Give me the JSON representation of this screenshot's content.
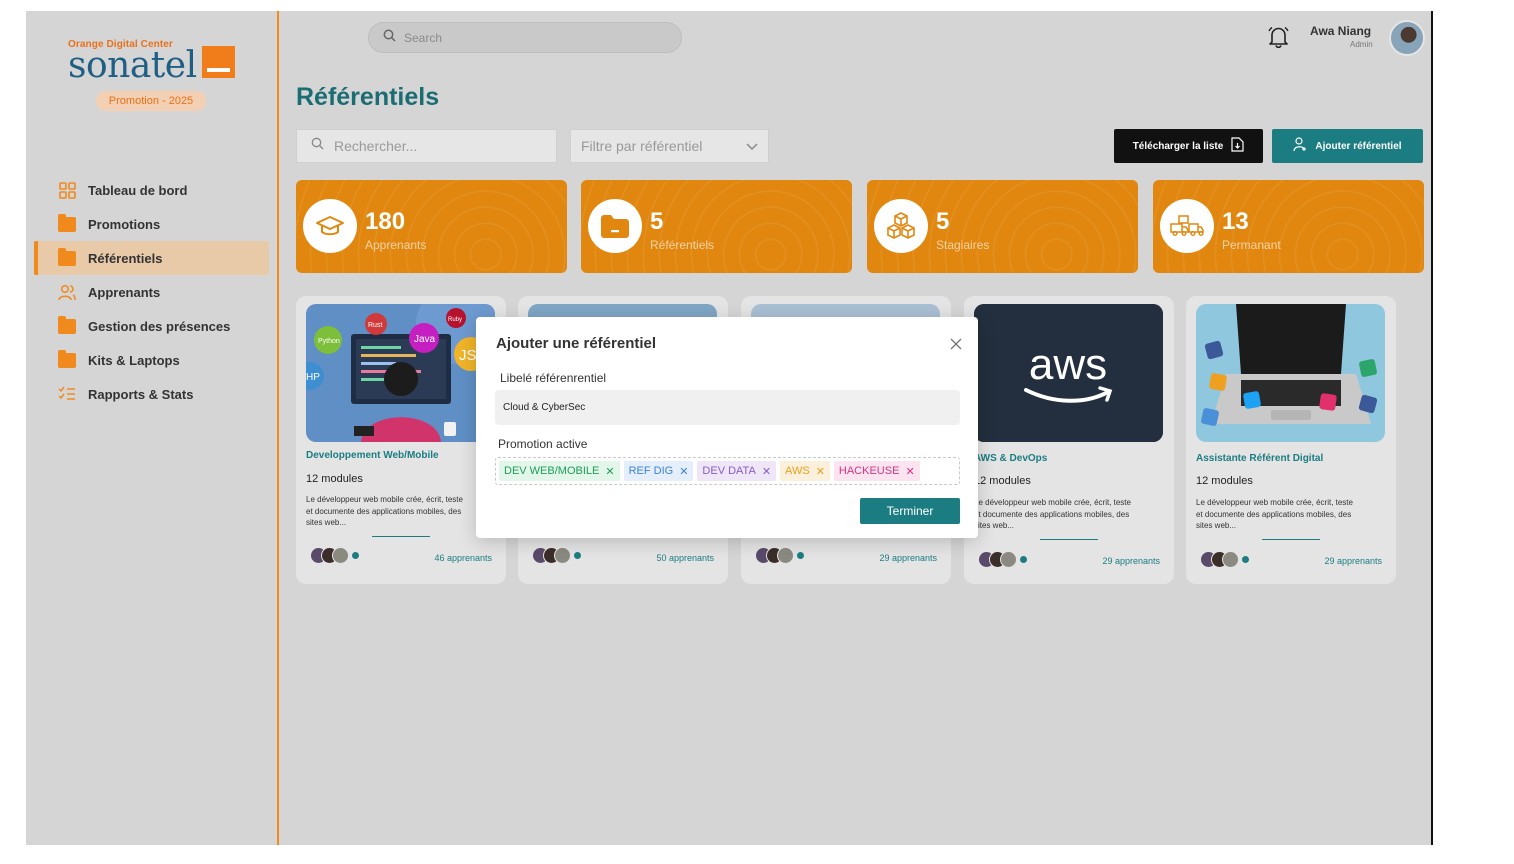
{
  "sidebar": {
    "logo_small": "Orange Digital Center",
    "logo_big": "sonatel",
    "promotion_pill": "Promotion - 2025",
    "items": [
      {
        "label": "Tableau de bord",
        "icon": "grid-icon",
        "active": false
      },
      {
        "label": "Promotions",
        "icon": "folder-icon",
        "active": false
      },
      {
        "label": "Référentiels",
        "icon": "folder-icon",
        "active": true
      },
      {
        "label": "Apprenants",
        "icon": "users-icon",
        "active": false
      },
      {
        "label": "Gestion des présences",
        "icon": "folder-icon",
        "active": false
      },
      {
        "label": "Kits & Laptops",
        "icon": "folder-icon",
        "active": false
      },
      {
        "label": "Rapports & Stats",
        "icon": "checklist-icon",
        "active": false
      }
    ]
  },
  "topbar": {
    "search_placeholder": "Search",
    "user_name": "Awa Niang",
    "user_role": "Admin"
  },
  "page": {
    "title": "Référentiels",
    "search_placeholder": "Rechercher...",
    "filter_placeholder": "Filtre par référentiel",
    "download_label": "Télécharger la liste",
    "add_label": "Ajouter référentiel"
  },
  "stats": [
    {
      "value": "180",
      "label": "Apprenants",
      "icon": "graduation-cap-icon"
    },
    {
      "value": "5",
      "label": "Référentiels",
      "icon": "folder-icon"
    },
    {
      "value": "5",
      "label": "Stagiaires",
      "icon": "cubes-icon"
    },
    {
      "value": "13",
      "label": "Permanant",
      "icon": "trucks-icon"
    }
  ],
  "cards": [
    {
      "title": "Developpement Web/Mobile",
      "modules": "12 modules",
      "desc": "Le développeur web mobile crée, écrit, teste et documente des applications mobiles, des sites web...",
      "count": "46 apprenants"
    },
    {
      "title": "",
      "modules": "",
      "desc": "",
      "count": "50 apprenants"
    },
    {
      "title": "",
      "modules": "",
      "desc": "",
      "count": "29 apprenants"
    },
    {
      "title": "AWS & DevOps",
      "modules": "12 modules",
      "desc": "Le développeur web mobile crée, écrit, teste et documente des applications mobiles, des sites web...",
      "count": "29 apprenants"
    },
    {
      "title": "Assistante Référent Digital",
      "modules": "12 modules",
      "desc": "Le développeur web mobile crée, écrit, teste et documente des applications mobiles, des sites web...",
      "count": "29 apprenants"
    }
  ],
  "card_images": {
    "dev_languages": [
      "Python",
      "Rust",
      "Ruby",
      "Java",
      "JS",
      "HP"
    ],
    "aws_logo": "aws"
  },
  "modal": {
    "title": "Ajouter une référentiel",
    "label_name": "Libelé référenrentiel",
    "name_value": "Cloud & CyberSec",
    "label_promo": "Promotion active",
    "tags": [
      {
        "label": "DEV WEB/MOBILE",
        "color": "#1e9e5a",
        "bg": "#e3f6ea"
      },
      {
        "label": "REF DIG",
        "color": "#3b82d6",
        "bg": "#e5effb"
      },
      {
        "label": "DEV DATA",
        "color": "#8b5cc9",
        "bg": "#efe7f8"
      },
      {
        "label": "AWS",
        "color": "#e8a21c",
        "bg": "#fbf0db"
      },
      {
        "label": "HACKEUSE",
        "color": "#d63384",
        "bg": "#fbe4ef"
      }
    ],
    "submit_label": "Terminer"
  },
  "colors": {
    "accent_orange": "#e1870f",
    "teal": "#1b7d82",
    "title_teal": "#1b6c73"
  }
}
